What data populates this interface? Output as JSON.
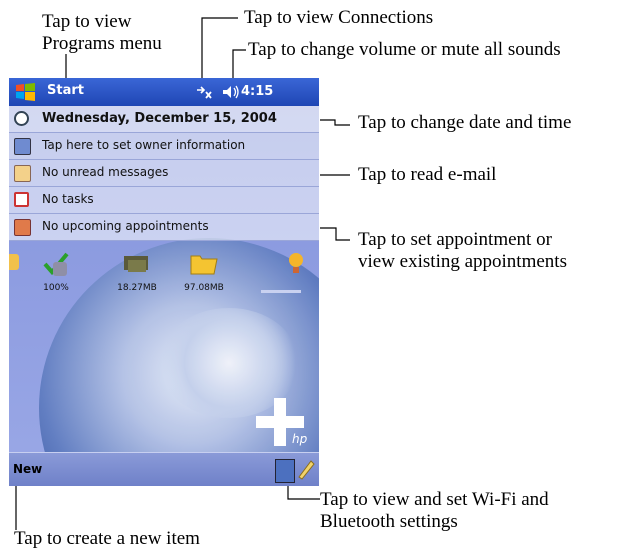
{
  "callouts": {
    "programs_line1": "Tap to view",
    "programs_line2": "Programs menu",
    "connections": "Tap to view Connections",
    "volume": "Tap to change volume or mute all sounds",
    "datetime": "Tap to change date and time",
    "email": "Tap to read e-mail",
    "appointments_line1": "Tap to set appointment or",
    "appointments_line2": "view existing appointments",
    "wifi_line1": "Tap to view and set Wi-Fi and",
    "wifi_line2": "Bluetooth settings",
    "new_item": "Tap to create a new item"
  },
  "screen": {
    "title": "Start",
    "time": "4:15",
    "rows": {
      "date": "Wednesday, December 15, 2004",
      "owner": "Tap here to set owner information",
      "messages": "No unread messages",
      "tasks": "No tasks",
      "appointments": "No upcoming appointments"
    },
    "icons": {
      "battery": "100%",
      "memory": "18.27MB",
      "storage": "97.08MB"
    },
    "menu_new": "New",
    "brand": "hp"
  },
  "colors": {
    "titlebar": "#2a55c8",
    "wallpaper": "#8c9be0",
    "menubar": "#7b8cd0"
  }
}
